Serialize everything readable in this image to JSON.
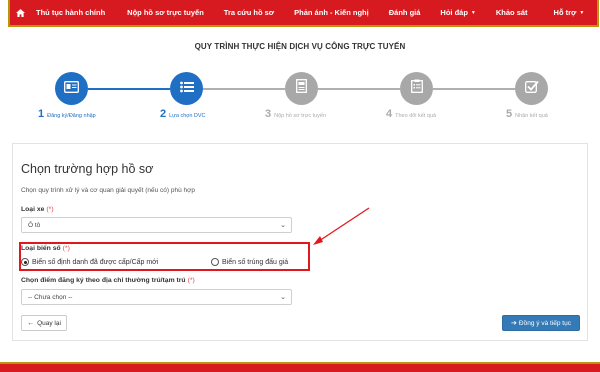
{
  "nav": {
    "items": [
      {
        "label": "Thủ tục hành chính",
        "dropdown": false
      },
      {
        "label": "Nộp hồ sơ trực tuyến",
        "dropdown": false
      },
      {
        "label": "Tra cứu hồ sơ",
        "dropdown": false
      },
      {
        "label": "Phản ánh - Kiến nghị",
        "dropdown": false
      },
      {
        "label": "Đánh giá",
        "dropdown": false
      },
      {
        "label": "Hỏi đáp",
        "dropdown": true
      },
      {
        "label": "Khảo sát",
        "dropdown": false
      },
      {
        "label": "Hỗ trợ",
        "dropdown": true
      }
    ],
    "bg_color": "#d71920",
    "border_color": "#b8960c"
  },
  "page_title": "QUY TRÌNH THỰC HIỆN DỊCH VỤ CÔNG TRỰC TUYẾN",
  "steps": [
    {
      "num": "1",
      "label": "Đăng ký/Đăng nhập",
      "icon": "id-card-icon",
      "active": true
    },
    {
      "num": "2",
      "label": "Lựa chọn DVC",
      "icon": "list-icon",
      "active": true
    },
    {
      "num": "3",
      "label": "Nộp hồ sơ trực tuyến",
      "icon": "document-icon",
      "active": false
    },
    {
      "num": "4",
      "label": "Theo dõi kết quả",
      "icon": "clipboard-icon",
      "active": false
    },
    {
      "num": "5",
      "label": "Nhận kết quả",
      "icon": "checkbox-icon",
      "active": false
    }
  ],
  "form": {
    "title": "Chọn trường hợp hồ sơ",
    "subtitle": "Chọn quy trình xử lý và cơ quan giải quyết (nếu có) phù hợp",
    "vehicle_type_label": "Loại xe",
    "vehicle_type_value": "Ô tô",
    "plate_type_label": "Loại biển số",
    "plate_options": [
      {
        "label": "Biển số định danh đã được cấp/Cấp mới",
        "checked": true
      },
      {
        "label": "Biển số trúng đấu giá",
        "checked": false
      }
    ],
    "registration_place_label": "Chọn điểm đăng ký theo địa chỉ thường trú/tạm trú",
    "registration_place_value": "-- Chưa chọn --",
    "required_mark": "(*)",
    "back_label": "Quay lại",
    "next_label": "Đồng ý và tiếp tục"
  },
  "colors": {
    "accent_blue": "#1f6fc5",
    "button_blue": "#337ab7",
    "highlight_red": "#e1171e",
    "inactive_gray": "#a8a8a8"
  }
}
